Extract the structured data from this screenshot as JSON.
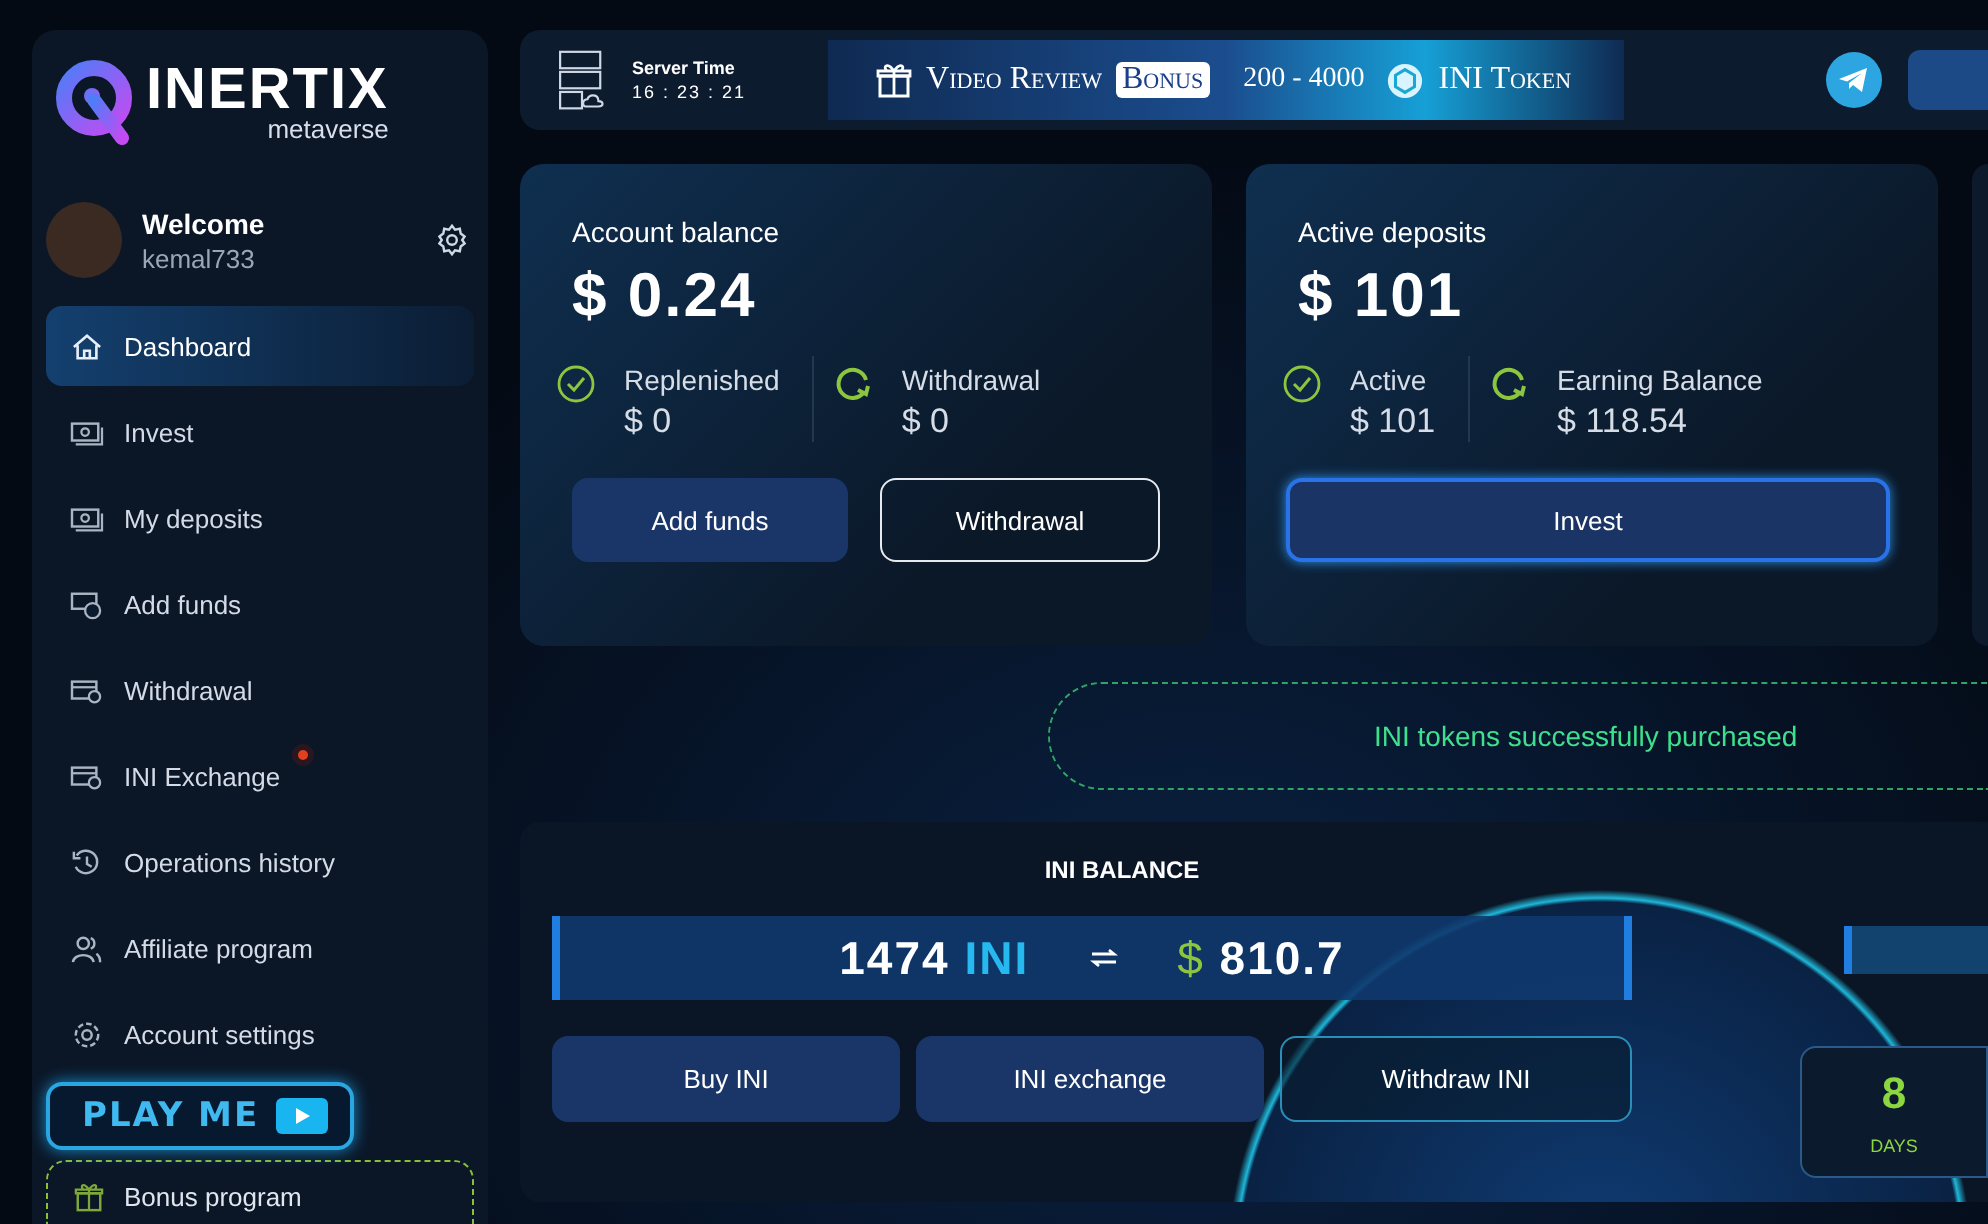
{
  "sidebar": {
    "logo": {
      "name": "INERTIX",
      "tagline": "metaverse"
    },
    "user": {
      "greeting": "Welcome",
      "username": "kemal733"
    },
    "items": [
      {
        "label": "Dashboard",
        "kind": "home",
        "selected": true,
        "notification": false
      },
      {
        "label": "Invest",
        "kind": "cash",
        "selected": false,
        "notification": false
      },
      {
        "label": "My deposits",
        "kind": "cash",
        "selected": false,
        "notification": false
      },
      {
        "label": "Add funds",
        "kind": "money",
        "selected": false,
        "notification": false
      },
      {
        "label": "Withdrawal",
        "kind": "card",
        "selected": false,
        "notification": false
      },
      {
        "label": "INI Exchange",
        "kind": "card",
        "selected": false,
        "notification": true
      },
      {
        "label": "Operations history",
        "kind": "history",
        "selected": false,
        "notification": false
      },
      {
        "label": "Affiliate program",
        "kind": "users",
        "selected": false,
        "notification": false
      },
      {
        "label": "Account settings",
        "kind": "gear",
        "selected": false,
        "notification": false
      }
    ],
    "play_button": {
      "label": "PLAY ME"
    },
    "bonus_item": {
      "label": "Bonus program"
    }
  },
  "top_bar": {
    "server_time": {
      "label": "Server Time",
      "time": "16 : 23 : 21"
    },
    "promo": {
      "title": "Video Review",
      "badge": "Bonus",
      "range": "200 - 4000",
      "token": "INI Token"
    }
  },
  "cards": [
    {
      "title": "Account balance",
      "amount": "$ 0.24",
      "stats": [
        {
          "label": "Replenished",
          "value": "$ 0",
          "kind": "check"
        },
        {
          "label": "Withdrawal",
          "value": "$ 0",
          "kind": "refresh"
        }
      ],
      "buttons": [
        {
          "label": "Add funds",
          "kind": "filled"
        },
        {
          "label": "Withdrawal",
          "kind": "outline"
        }
      ]
    },
    {
      "title": "Active deposits",
      "amount": "$ 101",
      "stats": [
        {
          "label": "Active",
          "value": "$ 101",
          "kind": "check"
        },
        {
          "label": "Earning Balance",
          "value": "$ 118.54",
          "kind": "refresh"
        }
      ],
      "buttons": [
        {
          "label": "Invest",
          "kind": "glow"
        }
      ]
    }
  ],
  "toast": {
    "message": "INI tokens successfully purchased"
  },
  "ini_balance": {
    "title": "INI BALANCE",
    "amount": "1474",
    "unit": "INI",
    "currency": "$",
    "usd": "810.7",
    "buttons": [
      {
        "label": "Buy INI",
        "kind": "filled"
      },
      {
        "label": "INI exchange",
        "kind": "filled"
      },
      {
        "label": "Withdraw INI",
        "kind": "outline"
      }
    ],
    "timer": {
      "value": "8",
      "unit": "DAYS"
    }
  }
}
